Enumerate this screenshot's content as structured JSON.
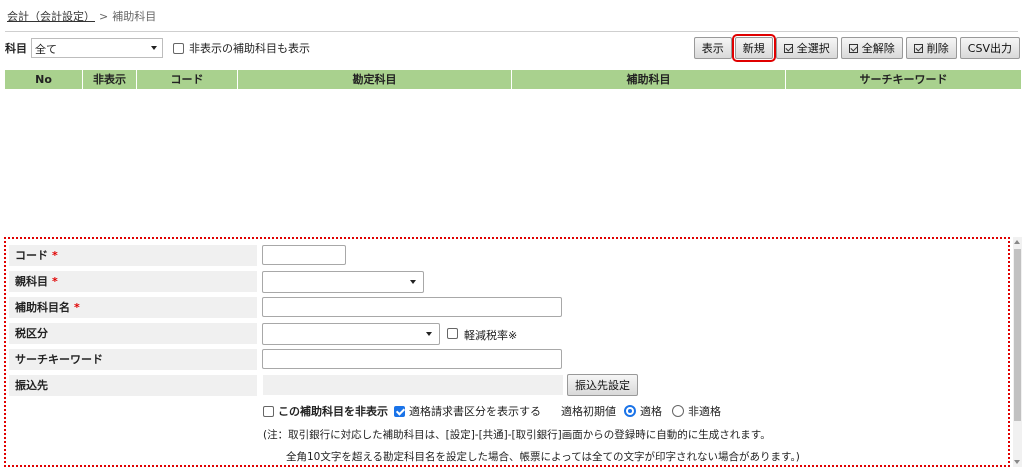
{
  "breadcrumb": {
    "parent": "会計（会計設定）",
    "separator": ">",
    "current": "補助科目"
  },
  "filter": {
    "label": "科目",
    "selected": "全て",
    "show_hidden_label": "非表示の補助科目も表示"
  },
  "toolbar": {
    "display": "表示",
    "new": "新規",
    "select_all": "全選択",
    "deselect_all": "全解除",
    "delete": "削除",
    "csv": "CSV出力"
  },
  "grid": {
    "columns": [
      "No",
      "非表示",
      "コード",
      "勘定科目",
      "補助科目",
      "サーチキーワード"
    ]
  },
  "form": {
    "code_label": "コード",
    "parent_label": "親科目",
    "name_label": "補助科目名",
    "tax_label": "税区分",
    "reduced_tax_label": "軽減税率※",
    "search_label": "サーチキーワード",
    "transfer_label": "振込先",
    "transfer_button": "振込先設定",
    "hide_label": "この補助科目を非表示",
    "invoice_label": "適格請求書区分を表示する",
    "invoice_default_label": "適格初期値",
    "qualified_label": "適格",
    "non_qualified_label": "非適格",
    "required_mark": "*",
    "note_line1": "(注：取引銀行に対応した補助科目は、[設定]-[共通]-[取引銀行]画面からの登録時に自動的に生成されます。",
    "note_line2": "全角10文字を超える勘定科目名を設定した場合、帳票によっては全ての文字が印字されない場合があります。)"
  },
  "colors": {
    "header_green": "#a9d18e",
    "highlight_red": "#e00000",
    "accent_blue": "#1a73e8"
  }
}
